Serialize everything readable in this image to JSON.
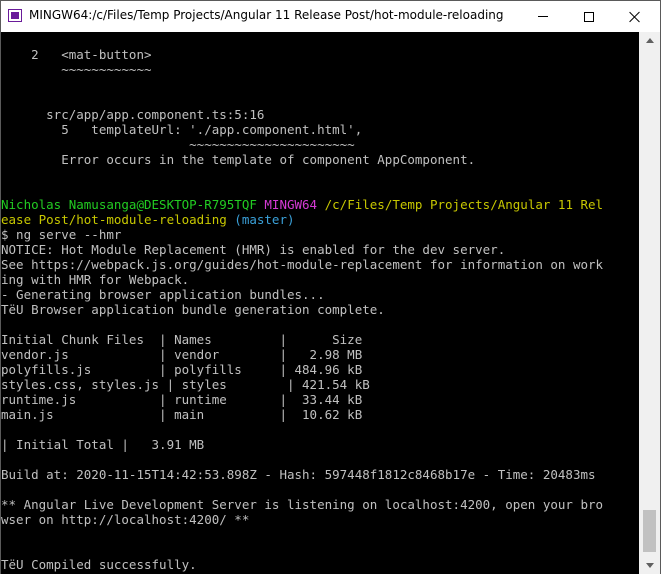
{
  "window": {
    "title": "MINGW64:/c/Files/Temp Projects/Angular 11 Release Post/hot-module-reloading"
  },
  "terminal": {
    "lines": [
      {
        "segments": [
          {
            "text": ""
          }
        ]
      },
      {
        "segments": [
          {
            "text": "    2   <mat-button>"
          }
        ]
      },
      {
        "segments": [
          {
            "text": "        ~~~~~~~~~~~~",
            "color": "tilde"
          }
        ]
      },
      {
        "segments": [
          {
            "text": ""
          }
        ]
      },
      {
        "segments": [
          {
            "text": ""
          }
        ]
      },
      {
        "segments": [
          {
            "text": "      src/app/app.component.ts:5:16"
          }
        ]
      },
      {
        "segments": [
          {
            "text": "        5   templateUrl: './app.component.html',"
          }
        ]
      },
      {
        "segments": [
          {
            "text": "                         ~~~~~~~~~~~~~~~~~~~~~~",
            "color": "tilde"
          }
        ]
      },
      {
        "segments": [
          {
            "text": "        Error occurs in the template of component AppComponent."
          }
        ]
      },
      {
        "segments": [
          {
            "text": ""
          }
        ]
      },
      {
        "segments": [
          {
            "text": ""
          }
        ]
      },
      {
        "segments": [
          {
            "text": "Nicholas Namusanga@DESKTOP-R795TQF ",
            "color": "green"
          },
          {
            "text": "MINGW64 ",
            "color": "magenta"
          },
          {
            "text": "/c/Files/Temp Projects/Angular 11 Rel",
            "color": "yellow"
          }
        ]
      },
      {
        "segments": [
          {
            "text": "ease Post/hot-module-reloading ",
            "color": "yellow"
          },
          {
            "text": "(master)",
            "color": "cyan"
          }
        ]
      },
      {
        "segments": [
          {
            "text": "$ ng serve --hmr"
          }
        ]
      },
      {
        "segments": [
          {
            "text": "NOTICE: Hot Module Replacement (HMR) is enabled for the dev server."
          }
        ]
      },
      {
        "segments": [
          {
            "text": "See https://webpack.js.org/guides/hot-module-replacement for information on work"
          }
        ]
      },
      {
        "segments": [
          {
            "text": "ing with HMR for Webpack."
          }
        ]
      },
      {
        "segments": [
          {
            "text": "- Generating browser application bundles..."
          }
        ]
      },
      {
        "segments": [
          {
            "text": "TëU Browser application bundle generation complete."
          }
        ]
      },
      {
        "segments": [
          {
            "text": ""
          }
        ]
      },
      {
        "segments": [
          {
            "text": "Initial Chunk Files  | Names         |      Size"
          }
        ]
      },
      {
        "segments": [
          {
            "text": "vendor.js            | vendor        |   2.98 MB"
          }
        ]
      },
      {
        "segments": [
          {
            "text": "polyfills.js         | polyfills     | 484.96 kB"
          }
        ]
      },
      {
        "segments": [
          {
            "text": "styles.css, styles.js | styles        | 421.54 kB"
          }
        ]
      },
      {
        "segments": [
          {
            "text": "runtime.js           | runtime       |  33.44 kB"
          }
        ]
      },
      {
        "segments": [
          {
            "text": "main.js              | main          |  10.62 kB"
          }
        ]
      },
      {
        "segments": [
          {
            "text": ""
          }
        ]
      },
      {
        "segments": [
          {
            "text": "| Initial Total |   3.91 MB"
          }
        ]
      },
      {
        "segments": [
          {
            "text": ""
          }
        ]
      },
      {
        "segments": [
          {
            "text": "Build at: 2020-11-15T14:42:53.898Z - Hash: 597448f1812c8468b17e - Time: 20483ms"
          }
        ]
      },
      {
        "segments": [
          {
            "text": ""
          }
        ]
      },
      {
        "segments": [
          {
            "text": "** Angular Live Development Server is listening on localhost:4200, open your bro"
          }
        ]
      },
      {
        "segments": [
          {
            "text": "wser on http://localhost:4200/ **"
          }
        ]
      },
      {
        "segments": [
          {
            "text": ""
          }
        ]
      },
      {
        "segments": [
          {
            "text": ""
          }
        ]
      },
      {
        "segments": [
          {
            "text": "TëU Compiled successfully."
          }
        ]
      }
    ]
  },
  "colors": {
    "tilde": "#c0c0c0",
    "green": "#22cc22",
    "magenta": "#d43ad4",
    "yellow": "#c8c800",
    "cyan": "#3aa0d8",
    "default": "#c0c0c0",
    "background": "#000000"
  },
  "icons": {
    "app": "mingw-terminal-icon",
    "minimize": "minimize-icon",
    "maximize": "maximize-icon",
    "close": "close-icon"
  }
}
